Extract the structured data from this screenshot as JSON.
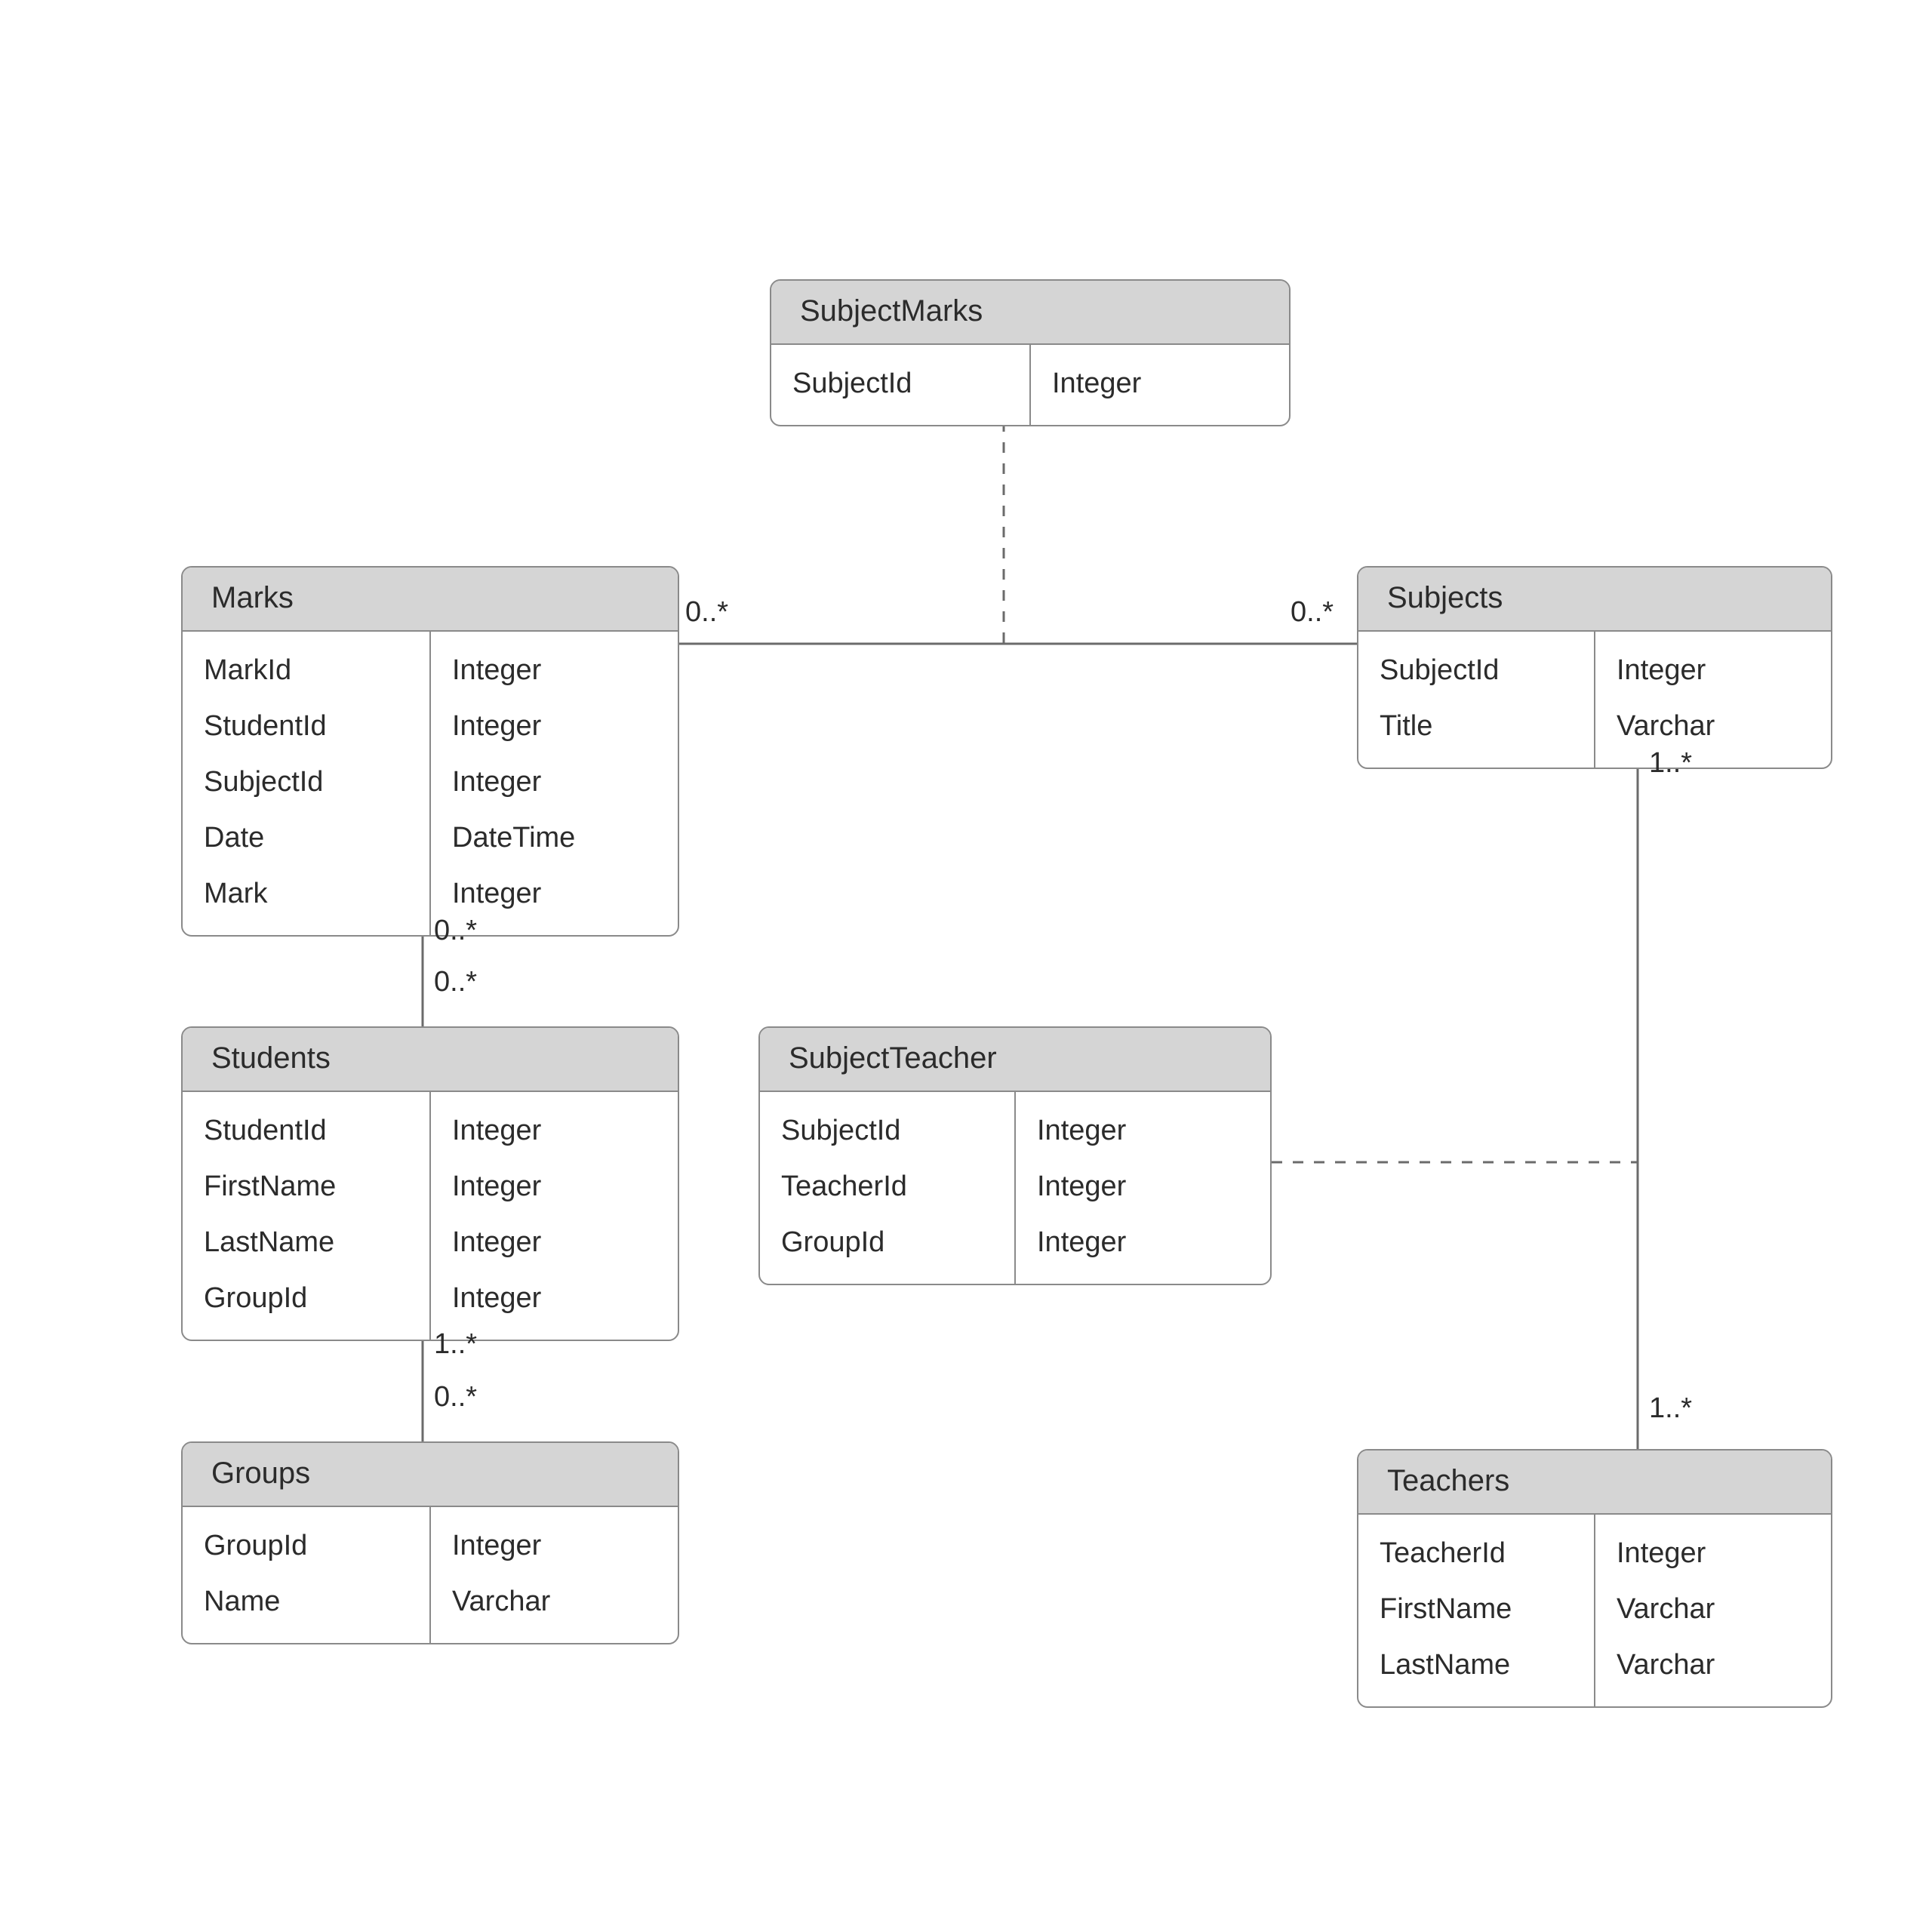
{
  "entities": {
    "subjectmarks": {
      "title": "SubjectMarks",
      "fields": [
        "SubjectId"
      ],
      "types": [
        "Integer"
      ]
    },
    "marks": {
      "title": "Marks",
      "fields": [
        "MarkId",
        "StudentId",
        "SubjectId",
        "Date",
        "Mark"
      ],
      "types": [
        "Integer",
        "Integer",
        "Integer",
        "DateTime",
        "Integer"
      ]
    },
    "subjects": {
      "title": "Subjects",
      "fields": [
        "SubjectId",
        "Title"
      ],
      "types": [
        "Integer",
        "Varchar"
      ]
    },
    "students": {
      "title": "Students",
      "fields": [
        "StudentId",
        "FirstName",
        "LastName",
        "GroupId"
      ],
      "types": [
        "Integer",
        "Integer",
        "Integer",
        "Integer"
      ]
    },
    "subjectteacher": {
      "title": "SubjectTeacher",
      "fields": [
        "SubjectId",
        "TeacherId",
        "GroupId"
      ],
      "types": [
        "Integer",
        "Integer",
        "Integer"
      ]
    },
    "groups": {
      "title": "Groups",
      "fields": [
        "GroupId",
        "Name"
      ],
      "types": [
        "Integer",
        "Varchar"
      ]
    },
    "teachers": {
      "title": "Teachers",
      "fields": [
        "TeacherId",
        "FirstName",
        "LastName"
      ],
      "types": [
        "Integer",
        "Varchar",
        "Varchar"
      ]
    }
  },
  "multiplicities": {
    "marks_subjects_left": "0..*",
    "marks_subjects_right": "0..*",
    "marks_students_top": "0..*",
    "marks_students_bottom": "0..*",
    "students_groups_top": "1..*",
    "students_groups_bottom": "0..*",
    "subjects_teachers_top": "1..*",
    "subjects_teachers_bottom": "1..*"
  }
}
